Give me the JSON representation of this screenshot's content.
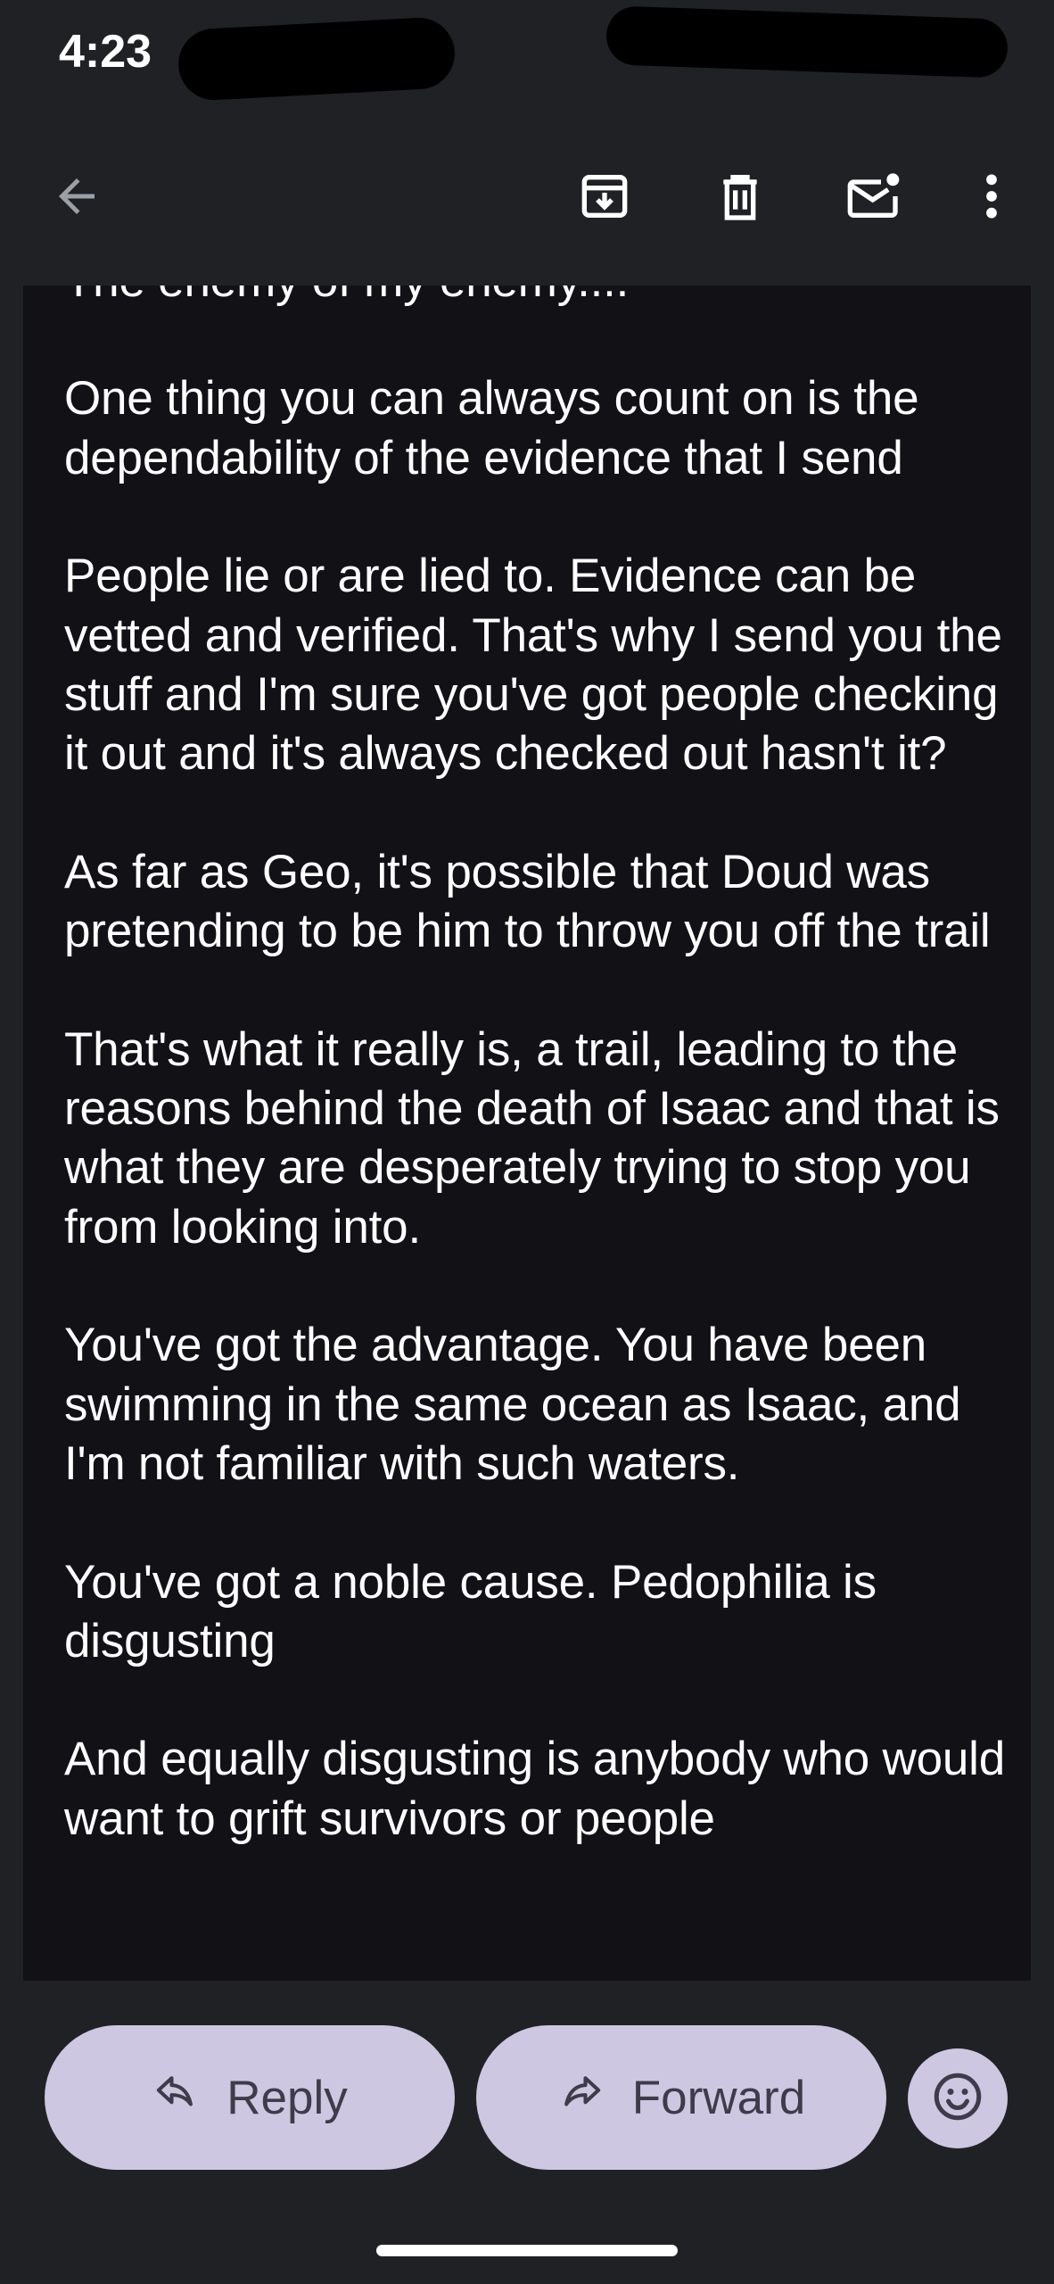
{
  "status_bar": {
    "time": "4:23"
  },
  "toolbar": {
    "icons": [
      "back-arrow-icon",
      "archive-icon",
      "delete-icon",
      "mark-unread-icon",
      "more-vert-icon"
    ]
  },
  "email": {
    "paragraphs": [
      "The enemy of my enemy....",
      "One thing you can always count on is the dependability of the evidence that I send",
      "People lie or are lied to. Evidence can be vetted and verified. That's why I send you the stuff and I'm sure you've got people checking it out and it's always checked out hasn't it?",
      "As far as Geo, it's possible that Doud was pretending to be him to throw you off the trail",
      "That's what it really is, a trail, leading to the reasons behind the death of Isaac and that is what they are desperately trying to stop you from looking into.",
      "You've got the advantage. You have been swimming in the same ocean as Isaac, and I'm not familiar with such waters.",
      "You've got a noble cause. Pedophilia is disgusting",
      "And equally disgusting is anybody who would want to grift survivors or people"
    ]
  },
  "actions": {
    "reply_label": "Reply",
    "forward_label": "Forward"
  },
  "colors": {
    "background": "#202125",
    "email_panel": "#121116",
    "button": "#cdc7e1",
    "button_text": "#3f3b4a"
  }
}
